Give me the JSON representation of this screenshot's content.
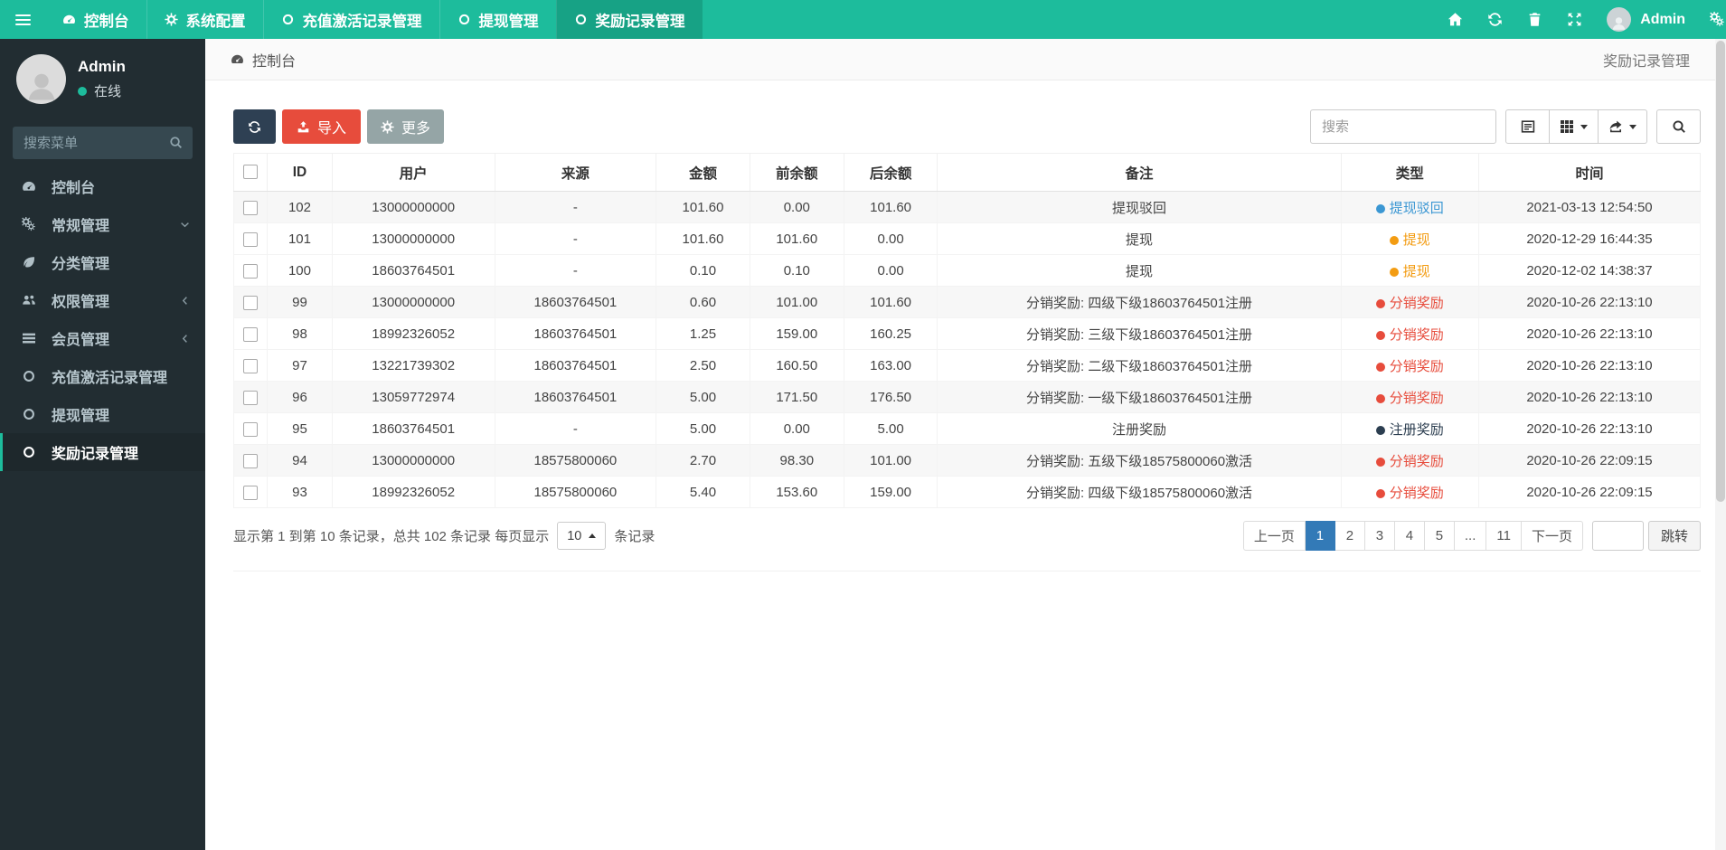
{
  "navbar": {
    "menu": [
      {
        "label": "控制台",
        "icon": "tachometer",
        "active": false
      },
      {
        "label": "系统配置",
        "icon": "gear",
        "active": false
      },
      {
        "label": "充值激活记录管理",
        "icon": "circle",
        "active": false
      },
      {
        "label": "提现管理",
        "icon": "circle",
        "active": false
      },
      {
        "label": "奖励记录管理",
        "icon": "circle",
        "active": true
      }
    ],
    "right": {
      "icons": [
        "home",
        "refresh",
        "trash",
        "expand"
      ],
      "admin_label": "Admin",
      "settings_icon": "gears"
    }
  },
  "sidebar": {
    "user": {
      "name": "Admin",
      "status": "在线"
    },
    "search_placeholder": "搜索菜单",
    "items": [
      {
        "label": "控制台",
        "icon": "tachometer",
        "chevron": "",
        "active": false
      },
      {
        "label": "常规管理",
        "icon": "gears",
        "chevron": "down",
        "active": false
      },
      {
        "label": "分类管理",
        "icon": "leaf",
        "chevron": "",
        "active": false
      },
      {
        "label": "权限管理",
        "icon": "users",
        "chevron": "left",
        "active": false
      },
      {
        "label": "会员管理",
        "icon": "list",
        "chevron": "left",
        "active": false
      },
      {
        "label": "充值激活记录管理",
        "icon": "circle",
        "chevron": "",
        "active": false
      },
      {
        "label": "提现管理",
        "icon": "circle",
        "chevron": "",
        "active": false
      },
      {
        "label": "奖励记录管理",
        "icon": "circle",
        "chevron": "",
        "active": true
      }
    ]
  },
  "breadcrumb": {
    "home": "控制台",
    "page_title": "奖励记录管理"
  },
  "toolbar": {
    "import_label": "导入",
    "more_label": "更多",
    "search_placeholder": "搜索"
  },
  "table": {
    "columns": [
      "ID",
      "用户",
      "来源",
      "金额",
      "前余额",
      "后余额",
      "备注",
      "类型",
      "时间"
    ],
    "rows": [
      {
        "id": "102",
        "user": "13000000000",
        "source": "-",
        "amount": "101.60",
        "before": "0.00",
        "after": "101.60",
        "remark": "提现驳回",
        "type": {
          "label": "提现驳回",
          "color_key": "withdraw_reject"
        },
        "time": "2021-03-13 12:54:50",
        "striped": true
      },
      {
        "id": "101",
        "user": "13000000000",
        "source": "-",
        "amount": "101.60",
        "before": "101.60",
        "after": "0.00",
        "remark": "提现",
        "type": {
          "label": "提现",
          "color_key": "withdraw"
        },
        "time": "2020-12-29 16:44:35",
        "striped": false
      },
      {
        "id": "100",
        "user": "18603764501",
        "source": "-",
        "amount": "0.10",
        "before": "0.10",
        "after": "0.00",
        "remark": "提现",
        "type": {
          "label": "提现",
          "color_key": "withdraw"
        },
        "time": "2020-12-02 14:38:37",
        "striped": false
      },
      {
        "id": "99",
        "user": "13000000000",
        "source": "18603764501",
        "amount": "0.60",
        "before": "101.00",
        "after": "101.60",
        "remark": "分销奖励: 四级下级18603764501注册",
        "type": {
          "label": "分销奖励",
          "color_key": "distribution"
        },
        "time": "2020-10-26 22:13:10",
        "striped": true
      },
      {
        "id": "98",
        "user": "18992326052",
        "source": "18603764501",
        "amount": "1.25",
        "before": "159.00",
        "after": "160.25",
        "remark": "分销奖励: 三级下级18603764501注册",
        "type": {
          "label": "分销奖励",
          "color_key": "distribution"
        },
        "time": "2020-10-26 22:13:10",
        "striped": false
      },
      {
        "id": "97",
        "user": "13221739302",
        "source": "18603764501",
        "amount": "2.50",
        "before": "160.50",
        "after": "163.00",
        "remark": "分销奖励: 二级下级18603764501注册",
        "type": {
          "label": "分销奖励",
          "color_key": "distribution"
        },
        "time": "2020-10-26 22:13:10",
        "striped": false
      },
      {
        "id": "96",
        "user": "13059772974",
        "source": "18603764501",
        "amount": "5.00",
        "before": "171.50",
        "after": "176.50",
        "remark": "分销奖励: 一级下级18603764501注册",
        "type": {
          "label": "分销奖励",
          "color_key": "distribution"
        },
        "time": "2020-10-26 22:13:10",
        "striped": true
      },
      {
        "id": "95",
        "user": "18603764501",
        "source": "-",
        "amount": "5.00",
        "before": "0.00",
        "after": "5.00",
        "remark": "注册奖励",
        "type": {
          "label": "注册奖励",
          "color_key": "register"
        },
        "time": "2020-10-26 22:13:10",
        "striped": false
      },
      {
        "id": "94",
        "user": "13000000000",
        "source": "18575800060",
        "amount": "2.70",
        "before": "98.30",
        "after": "101.00",
        "remark": "分销奖励: 五级下级18575800060激活",
        "type": {
          "label": "分销奖励",
          "color_key": "distribution"
        },
        "time": "2020-10-26 22:09:15",
        "striped": true
      },
      {
        "id": "93",
        "user": "18992326052",
        "source": "18575800060",
        "amount": "5.40",
        "before": "153.60",
        "after": "159.00",
        "remark": "分销奖励: 四级下级18575800060激活",
        "type": {
          "label": "分销奖励",
          "color_key": "distribution"
        },
        "time": "2020-10-26 22:09:15",
        "striped": false
      }
    ]
  },
  "pagination": {
    "summary_prefix": "显示第 1 到第 10 条记录，总共 102 条记录 每页显示",
    "page_size": "10",
    "summary_suffix": "条记录",
    "prev_label": "上一页",
    "pages": [
      "1",
      "2",
      "3",
      "4",
      "5",
      "...",
      "11"
    ],
    "active_page": "1",
    "next_label": "下一页",
    "jump_label": "跳转"
  },
  "colors": {
    "accent": "#1dbc9c",
    "navbar_active": "#17a285",
    "sidebar_bg": "#222d32",
    "refresh_button": "#2e4053",
    "import_button": "#e74c3c",
    "more_button": "#95a5a6",
    "active_page": "#337ab7",
    "types": {
      "withdraw_reject": "#3b97d3",
      "withdraw": "#f39c12",
      "distribution": "#e74c3c",
      "register": "#2c3e50"
    }
  }
}
